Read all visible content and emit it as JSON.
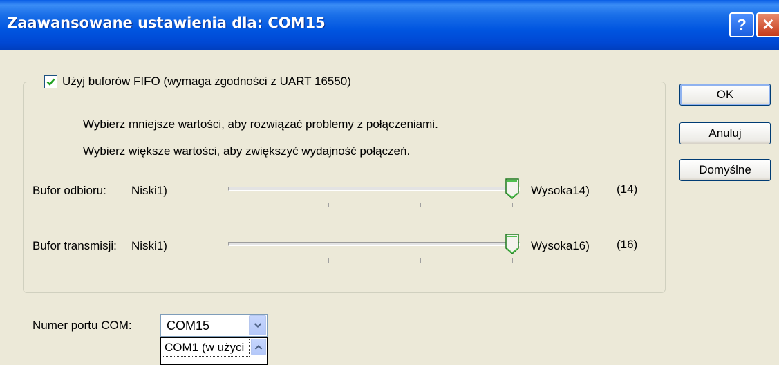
{
  "window": {
    "title": "Zaawansowane ustawienia dla: COM15",
    "help_glyph": "?",
    "close_glyph": "✕"
  },
  "fifo": {
    "checkbox_label": "Użyj buforów FIFO (wymaga zgodności z UART 16550)",
    "checked": true,
    "hint_lower": "Wybierz mniejsze wartości, aby rozwiązać problemy z połączeniami.",
    "hint_higher": "Wybierz większe wartości, aby zwiększyć wydajność połączeń."
  },
  "receive_buffer": {
    "label": "Bufor odbioru:",
    "min_label": "Niski1)",
    "max_label": "Wysoka14)",
    "value_text": "(14)",
    "value": 14,
    "min": 1,
    "max": 14
  },
  "transmit_buffer": {
    "label": "Bufor transmisji:",
    "min_label": "Niski1)",
    "max_label": "Wysoka16)",
    "value_text": "(16)",
    "value": 16,
    "min": 1,
    "max": 16
  },
  "buttons": {
    "ok": "OK",
    "cancel": "Anuluj",
    "defaults": "Domyślne"
  },
  "com_port": {
    "label": "Numer portu COM:",
    "selected": "COM15",
    "dropdown_items": [
      "COM1 (w użyci"
    ]
  },
  "icons": {
    "check": "check-icon",
    "combo_arrow": "chevron-down-icon",
    "scroll_up": "chevron-up-icon"
  },
  "colors": {
    "titlebar": "#0055e0",
    "face": "#ece9d8",
    "accent_border": "#003c74",
    "check": "#21a121"
  }
}
